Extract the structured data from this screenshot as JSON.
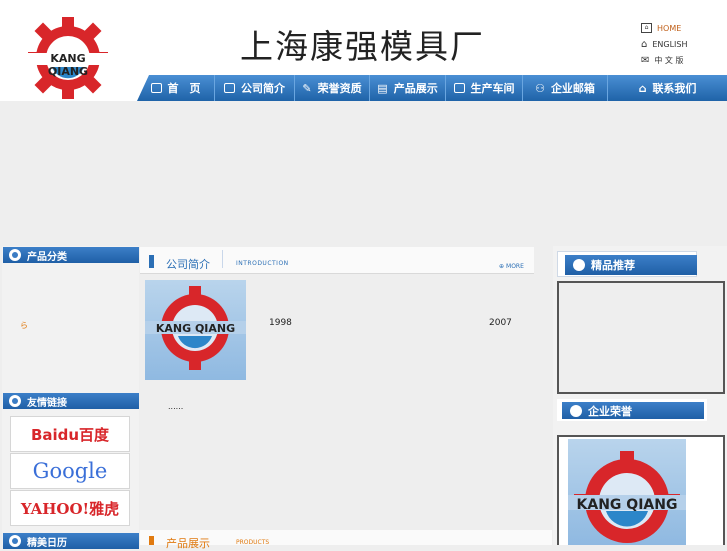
{
  "header": {
    "logo_text": "KANG QIANG",
    "site_title": "上海康强模具厂",
    "lang_links": [
      {
        "label": "HOME",
        "icon": "home-icon"
      },
      {
        "label": "ENGLISH",
        "icon": "house-icon"
      },
      {
        "label": "中 文 版",
        "icon": "mail-icon"
      }
    ]
  },
  "nav": [
    {
      "label": "首　页",
      "icon": "monitor-icon"
    },
    {
      "label": "公司简介",
      "icon": "card-icon"
    },
    {
      "label": "荣誉资质",
      "icon": "pen-icon"
    },
    {
      "label": "产品展示",
      "icon": "document-icon"
    },
    {
      "label": "生产车间",
      "icon": "briefcase-icon"
    },
    {
      "label": "企业邮箱",
      "icon": "people-icon"
    },
    {
      "label": "联系我们",
      "icon": "house-icon"
    }
  ],
  "left": {
    "product_category": "产品分类",
    "category_marker": "ら",
    "friend_links": "友情链接",
    "links": [
      "Baidu百度",
      "Google",
      "YAHOO!雅虎"
    ],
    "calendar": "精美日历"
  },
  "intro": {
    "title": "公司简介",
    "subtitle": "INTRODUCTION",
    "more": "MORE",
    "logo_text": "KANG QIANG",
    "year_founded": "1998",
    "year_2": "2007",
    "ellipsis": "......"
  },
  "products": {
    "title": "产品展示",
    "subtitle": "PRODUCTS"
  },
  "right": {
    "recommended": "精品推荐",
    "honor": "企业荣誉",
    "logo_text": "KANG QIANG"
  },
  "colors": {
    "brand_red": "#d8262a",
    "brand_blue": "#2c86c9",
    "nav_blue": "#2b6fb5"
  }
}
